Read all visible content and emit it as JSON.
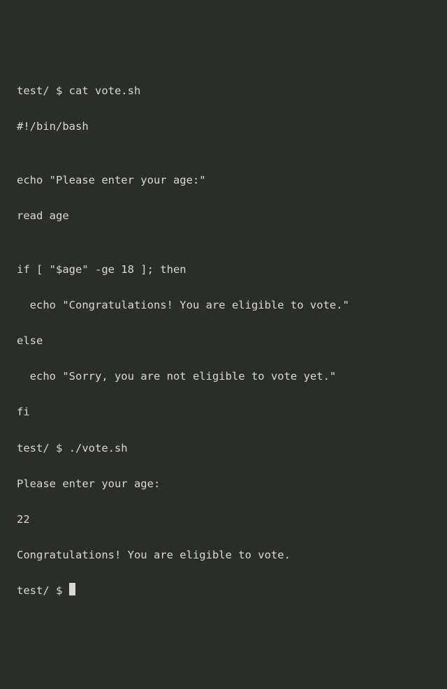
{
  "terminal": {
    "lines": [
      "test/ $ cat vote.sh",
      "#!/bin/bash",
      "",
      "echo \"Please enter your age:\"",
      "read age",
      "",
      "if [ \"$age\" -ge 18 ]; then",
      "  echo \"Congratulations! You are eligible to vote.\"",
      "else",
      "  echo \"Sorry, you are not eligible to vote yet.\"",
      "fi",
      "test/ $ ./vote.sh",
      "Please enter your age:",
      "22",
      "Congratulations! You are eligible to vote.",
      "test/ $ "
    ],
    "cursor": true
  }
}
